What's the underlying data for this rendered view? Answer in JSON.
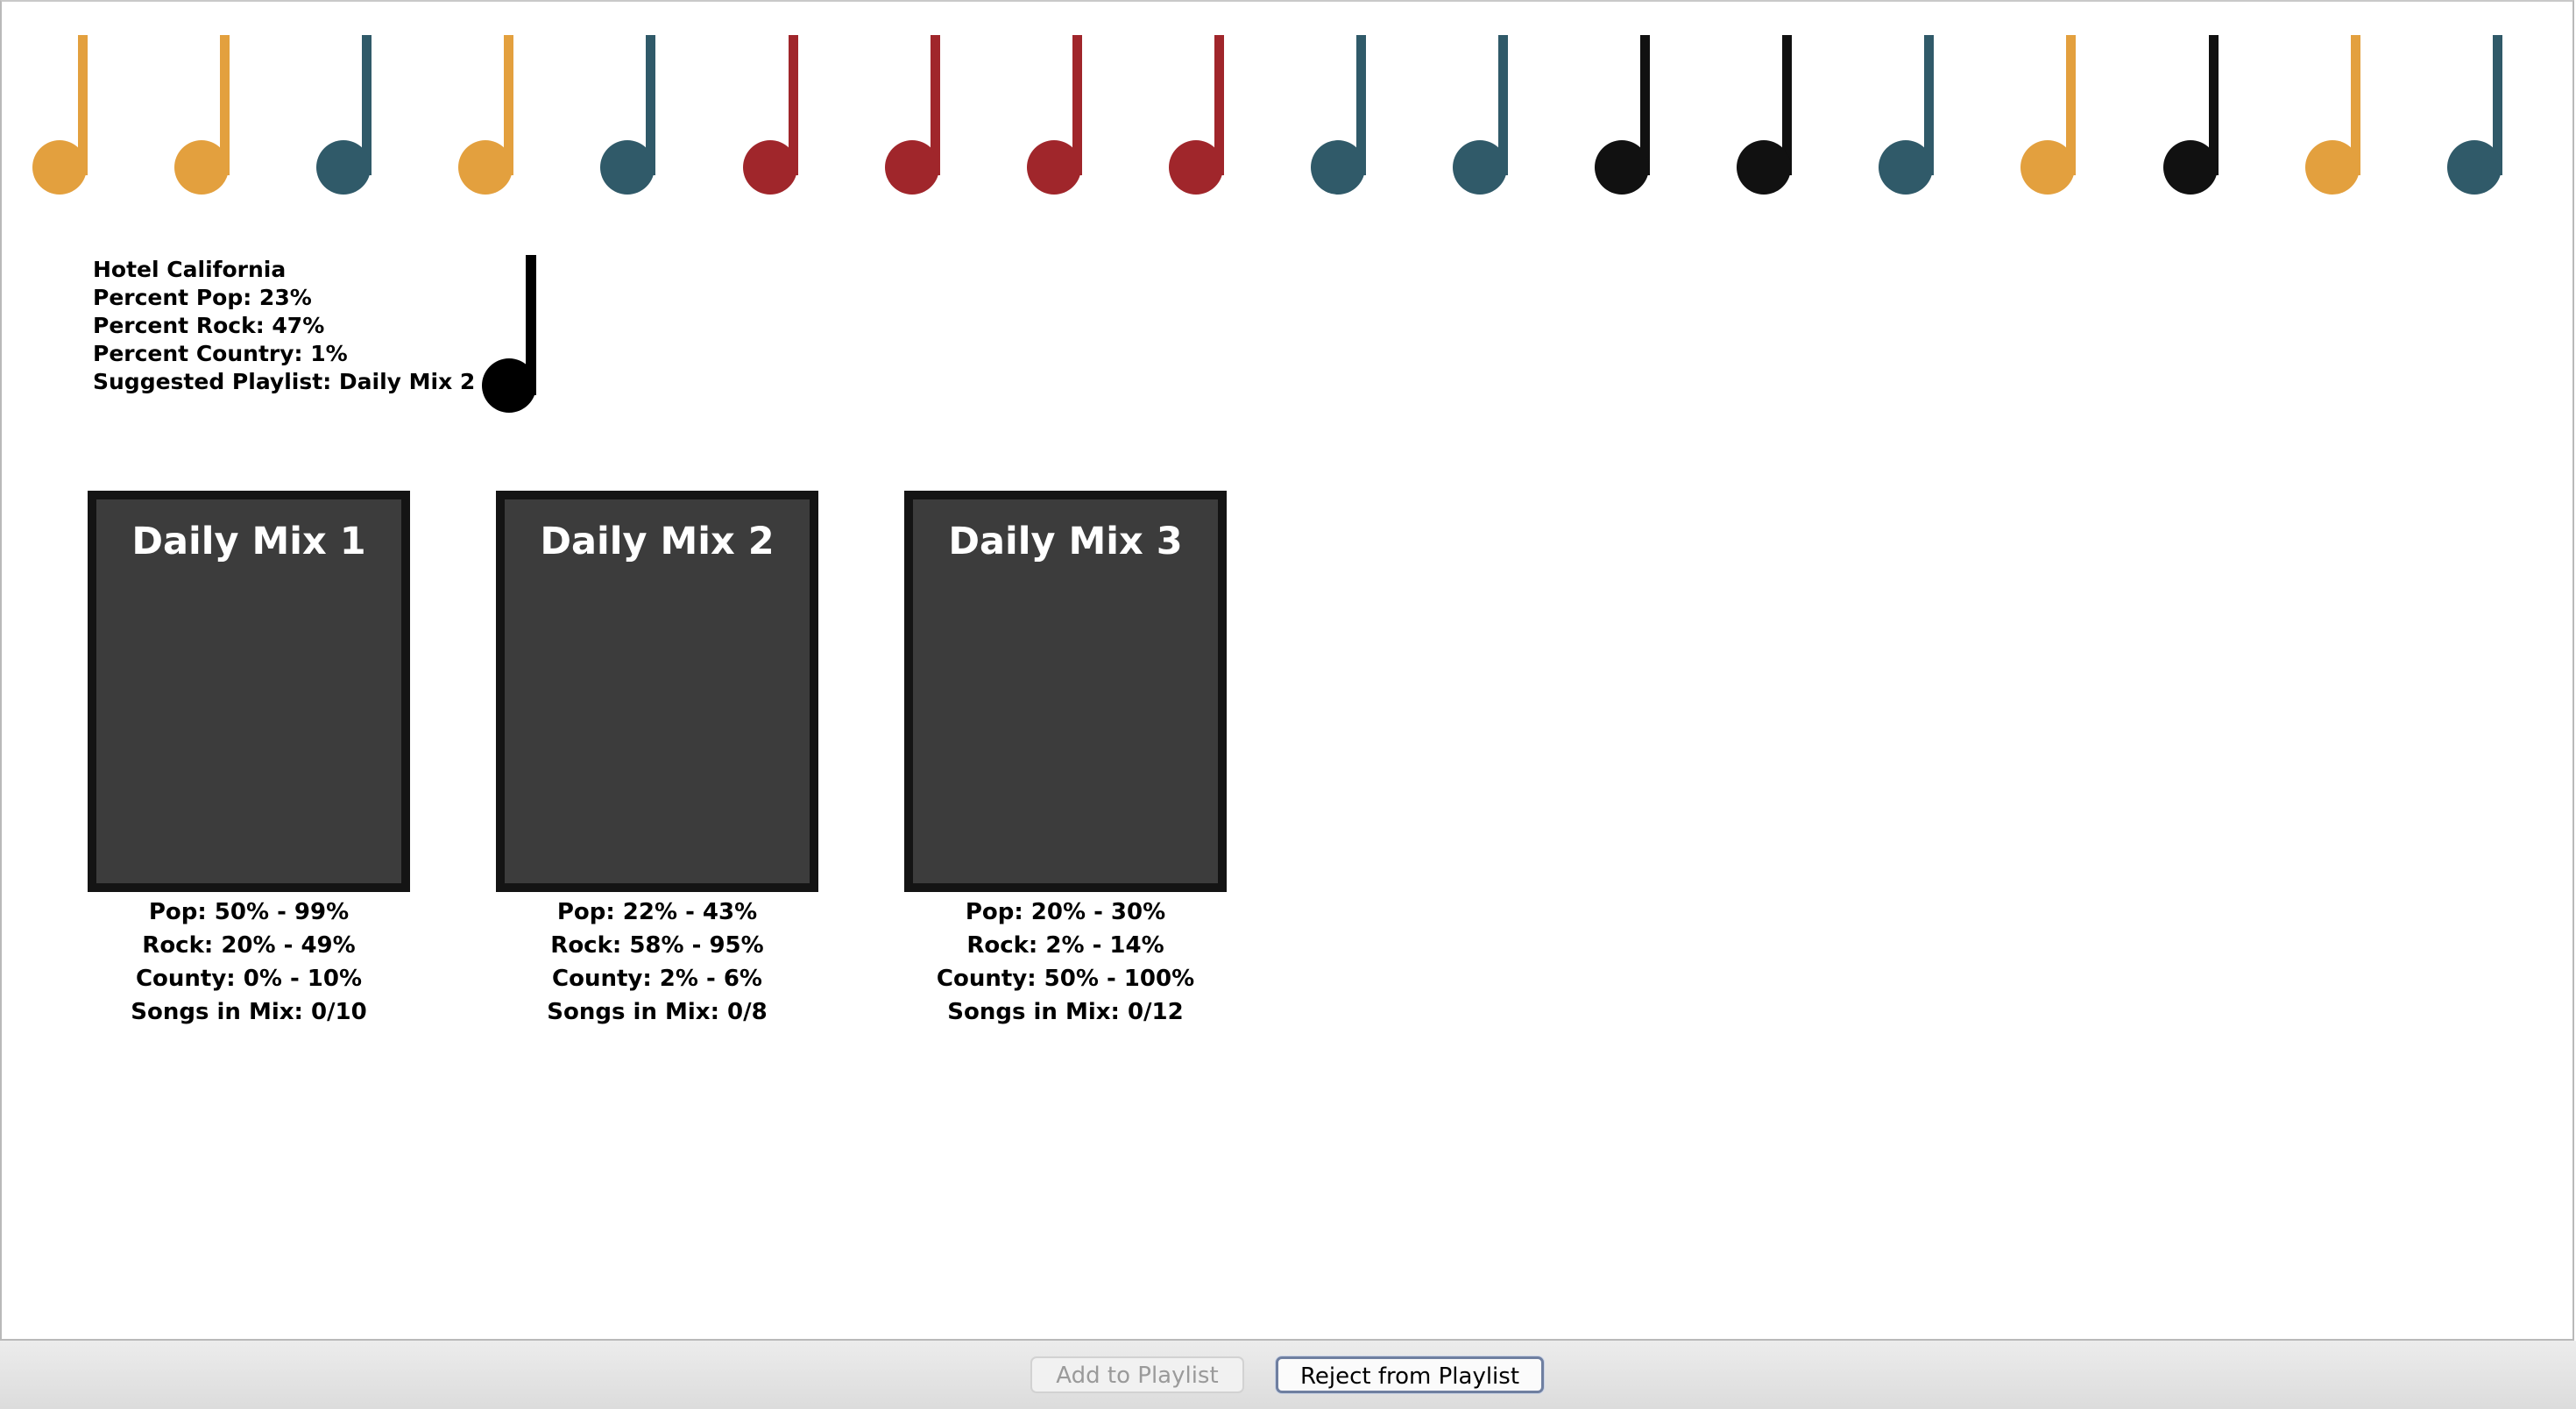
{
  "note_colors": {
    "orange": "#e3a03e",
    "teal": "#305a69",
    "red": "#a0262b",
    "black": "#111111"
  },
  "note_row": [
    "orange",
    "orange",
    "teal",
    "orange",
    "teal",
    "red",
    "red",
    "red",
    "red",
    "teal",
    "teal",
    "black",
    "black",
    "teal",
    "orange",
    "black",
    "orange",
    "teal"
  ],
  "current_song": {
    "title": "Hotel California",
    "percent_pop": "Percent Pop: 23%",
    "percent_rock": "Percent Rock: 47%",
    "percent_country": "Percent Country: 1%",
    "suggested_playlist": "Suggested Playlist: Daily Mix 2",
    "note_color": "#000000"
  },
  "mixes": [
    {
      "title": "Daily Mix 1",
      "pop": "Pop: 50% - 99%",
      "rock": "Rock: 20% - 49%",
      "county": "County: 0% - 10%",
      "songs": "Songs in Mix: 0/10"
    },
    {
      "title": "Daily Mix 2",
      "pop": "Pop: 22% - 43%",
      "rock": "Rock: 58% - 95%",
      "county": "County: 2% - 6%",
      "songs": "Songs in Mix: 0/8"
    },
    {
      "title": "Daily Mix 3",
      "pop": "Pop: 20% - 30%",
      "rock": "Rock: 2% - 14%",
      "county": "County: 50% - 100%",
      "songs": "Songs in Mix: 0/12"
    }
  ],
  "toolbar": {
    "add_label": "Add to Playlist",
    "add_enabled": false,
    "reject_label": "Reject from Playlist"
  }
}
